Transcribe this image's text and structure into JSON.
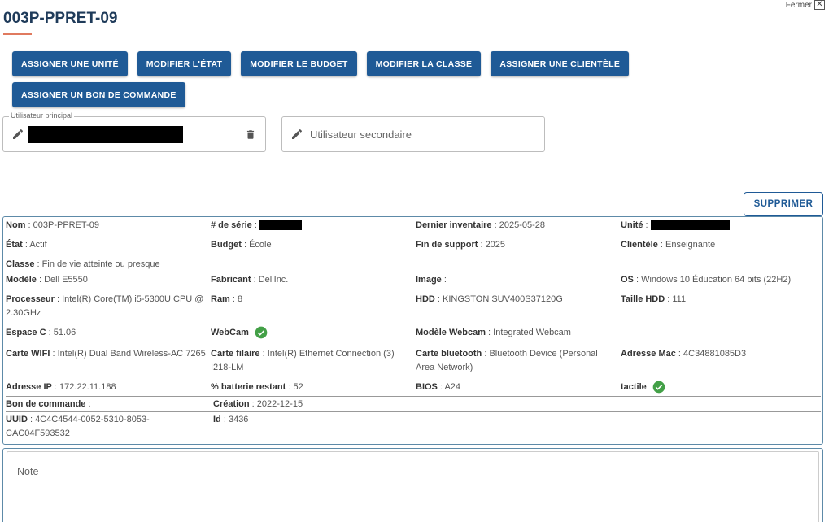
{
  "header": {
    "title": "003P-PPRET-09",
    "close_label": "Fermer"
  },
  "actions": {
    "row1": [
      "ASSIGNER UNE UNITÉ",
      "MODIFIER L'ÉTAT",
      "MODIFIER LE BUDGET",
      "MODIFIER LA CLASSE",
      "ASSIGNER UNE CLIENTÈLE"
    ],
    "row2": [
      "ASSIGNER UN BON DE COMMANDE"
    ],
    "delete": "SUPPRIMER"
  },
  "users": {
    "primary_legend": "Utilisateur principal",
    "secondary_label": "Utilisateur secondaire"
  },
  "info": {
    "nom": {
      "label": "Nom",
      "value": "003P-PPRET-09"
    },
    "serie": {
      "label": "# de série",
      "value": ""
    },
    "dernier_inventaire": {
      "label": "Dernier inventaire",
      "value": "2025-05-28"
    },
    "unite": {
      "label": "Unité",
      "value": ""
    },
    "etat": {
      "label": "État",
      "value": "Actif"
    },
    "budget": {
      "label": "Budget",
      "value": "École"
    },
    "fin_support": {
      "label": "Fin de support",
      "value": "2025"
    },
    "clientele": {
      "label": "Clientèle",
      "value": "Enseignante"
    },
    "classe": {
      "label": "Classe",
      "value": "Fin de vie atteinte ou presque"
    },
    "modele": {
      "label": "Modèle",
      "value": "Dell E5550"
    },
    "fabricant": {
      "label": "Fabricant",
      "value": "DellInc."
    },
    "image": {
      "label": "Image",
      "value": ""
    },
    "os": {
      "label": "OS",
      "value": "Windows 10 Éducation 64 bits (22H2)"
    },
    "processeur": {
      "label": "Processeur",
      "value": "Intel(R) Core(TM) i5-5300U CPU @ 2.30GHz"
    },
    "ram": {
      "label": "Ram",
      "value": "8"
    },
    "hdd": {
      "label": "HDD",
      "value": "KINGSTON SUV400S37120G"
    },
    "taille_hdd": {
      "label": "Taille HDD",
      "value": "111"
    },
    "espace_c": {
      "label": "Espace C",
      "value": "51.06"
    },
    "webcam": {
      "label": "WebCam",
      "value": true
    },
    "modele_webcam": {
      "label": "Modèle Webcam",
      "value": "Integrated Webcam"
    },
    "carte_wifi": {
      "label": "Carte WIFI",
      "value": "Intel(R) Dual Band Wireless-AC 7265"
    },
    "carte_filaire": {
      "label": "Carte filaire",
      "value": "Intel(R) Ethernet Connection (3) I218-LM"
    },
    "carte_bluetooth": {
      "label": "Carte bluetooth",
      "value": "Bluetooth Device (Personal Area Network)"
    },
    "adresse_mac": {
      "label": "Adresse Mac",
      "value": "4C34881085D3"
    },
    "adresse_ip": {
      "label": "Adresse IP",
      "value": "172.22.11.188"
    },
    "batterie": {
      "label": "% batterie restant",
      "value": "52"
    },
    "bios": {
      "label": "BIOS",
      "value": "A24"
    },
    "tactile": {
      "label": "tactile",
      "value": true
    },
    "bon_commande": {
      "label": "Bon de commande",
      "value": ""
    },
    "creation": {
      "label": "Création",
      "value": "2022-12-15"
    },
    "uuid": {
      "label": "UUID",
      "value": "4C4C4544-0052-5310-8053-CAC04F593532"
    },
    "id": {
      "label": "Id",
      "value": "3436"
    }
  },
  "note": {
    "placeholder": "Note"
  },
  "colors": {
    "primary": "#1f5a96",
    "title": "#1f3b5a",
    "accent": "#e07a5f",
    "success": "#43a047"
  }
}
